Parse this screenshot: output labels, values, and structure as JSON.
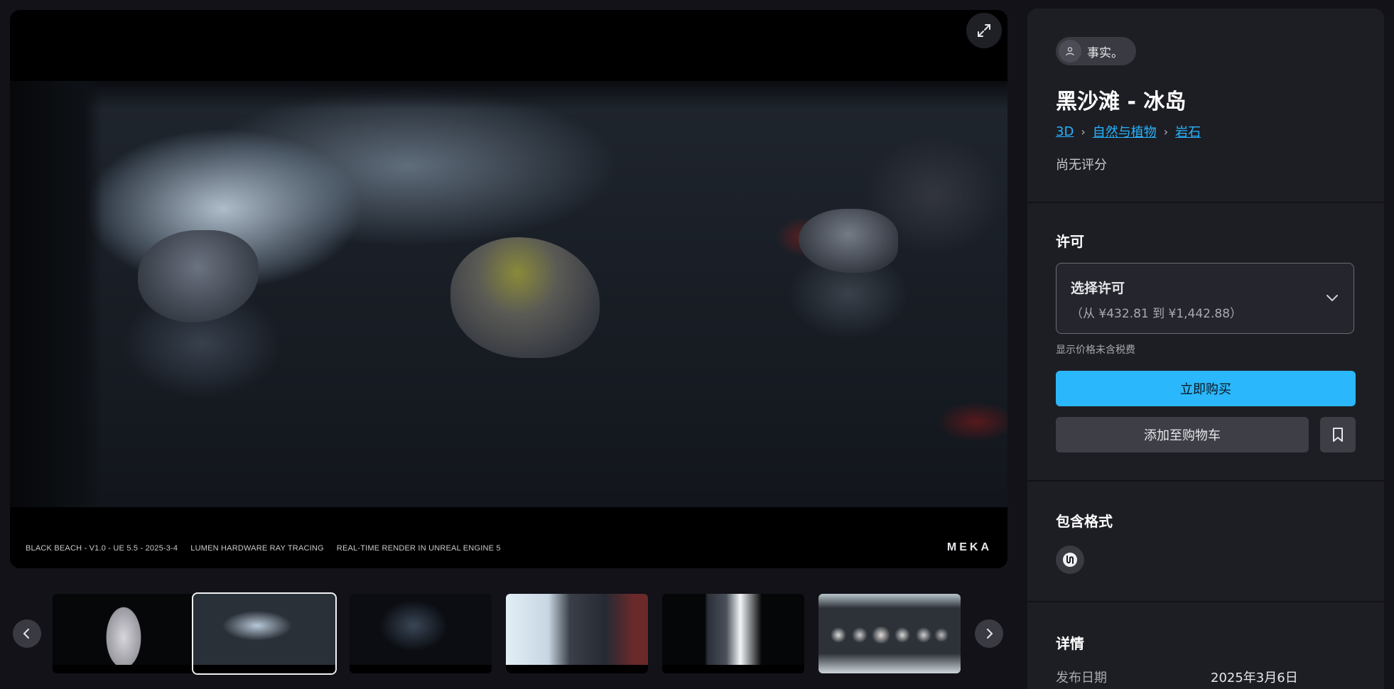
{
  "viewer": {
    "caption_items": [
      "BLACK BEACH - V1.0 - UE 5.5 - 2025-3-4",
      "LUMEN HARDWARE RAY TRACING",
      "REAL-TIME RENDER IN UNREAL ENGINE 5"
    ],
    "brand": "MEKA",
    "maximize_icon": "maximize-arrows-icon"
  },
  "thumbnails": {
    "prev_icon": "chevron-left-icon",
    "next_icon": "chevron-right-icon",
    "active_index": 1,
    "count": 6
  },
  "product": {
    "seller": {
      "name": "事实。",
      "icon": "user-icon"
    },
    "title": "黑沙滩 - 冰岛",
    "breadcrumbs": [
      "3D",
      "自然与植物",
      "岩石"
    ],
    "rating": "尚无评分"
  },
  "license": {
    "heading": "许可",
    "select_label": "选择许可",
    "price_range": "（从 ¥432.81 到 ¥1,442.88）",
    "tax_note": "显示价格未含税费",
    "buy_now": "立即购买",
    "add_to_cart": "添加至购物车",
    "wishlist_icon": "bookmark-icon"
  },
  "formats": {
    "heading": "包含格式",
    "items": [
      "unreal-engine-icon"
    ]
  },
  "details": {
    "heading": "详情",
    "rows": [
      {
        "label": "发布日期",
        "value": "2025年3月6日"
      }
    ]
  },
  "colors": {
    "accent": "#2ab7fb",
    "link": "#26b4ff",
    "panel_bg": "#1d1e24",
    "page_bg": "#121218"
  }
}
